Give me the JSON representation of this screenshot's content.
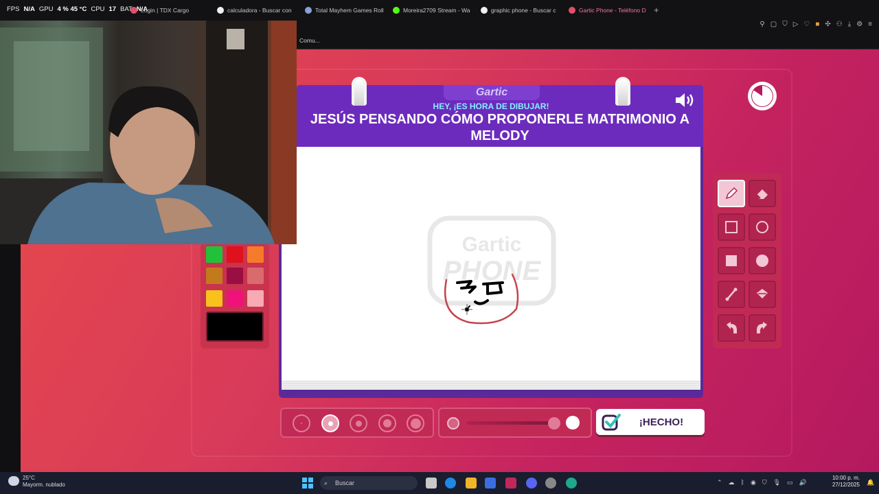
{
  "hud": {
    "fps_label": "FPS",
    "fps_value": "N/A",
    "gpu_label": "GPU",
    "gpu_value": "4 % 45 °C",
    "cpu_label": "CPU",
    "cpu_value": "17",
    "bat_label": "BAT",
    "bat_value": "N/A"
  },
  "tabs": [
    {
      "label": "Login | TDX Cargo",
      "color": "#e0506a"
    },
    {
      "label": "calculadora - Buscar con",
      "color": "#f0f0f0"
    },
    {
      "label": "Total Mayhem Games Roll",
      "color": "#8aa0d8"
    },
    {
      "label": "Moreira2709 Stream - Wa",
      "color": "#53fc18"
    },
    {
      "label": "graphic phone - Buscar c",
      "color": "#f0f0f0"
    },
    {
      "label": "Gartic Phone - Teléfono D",
      "color": "#e0506a"
    }
  ],
  "bookmark_label": "Comu...",
  "game": {
    "logo": "Gartic",
    "subtitle": "HEY, ¡ES HORA DE DIBUJAR!",
    "phrase": "JESÚS PENSANDO CÓMO PROPONERLE MATRIMONIO A MELODY",
    "watermark_top": "Gartic",
    "watermark_bottom": "PHONE",
    "done_label": "¡HECHO!"
  },
  "palette": {
    "colors": [
      "#22c13a",
      "#e0101c",
      "#f57a2a",
      "#c27a1c",
      "#9a0e44",
      "#d96a6e",
      "#f7c21c",
      "#f0127a",
      "#f7a9b4"
    ],
    "current": "#000000"
  },
  "tools": [
    "pencil-icon",
    "eraser-icon",
    "square-outline-icon",
    "circle-outline-icon",
    "square-filled-icon",
    "circle-filled-icon",
    "line-icon",
    "fill-bucket-icon",
    "undo-icon",
    "redo-icon"
  ],
  "brush_sizes": [
    1,
    2,
    3,
    4,
    5
  ],
  "selected_brush_size": 2,
  "opacity_percent": 100,
  "taskbar": {
    "temperature": "25°C",
    "weather": "Mayorm. nublado",
    "search_placeholder": "Buscar",
    "time": "10:00 p. m.",
    "date": "27/12/2025"
  }
}
